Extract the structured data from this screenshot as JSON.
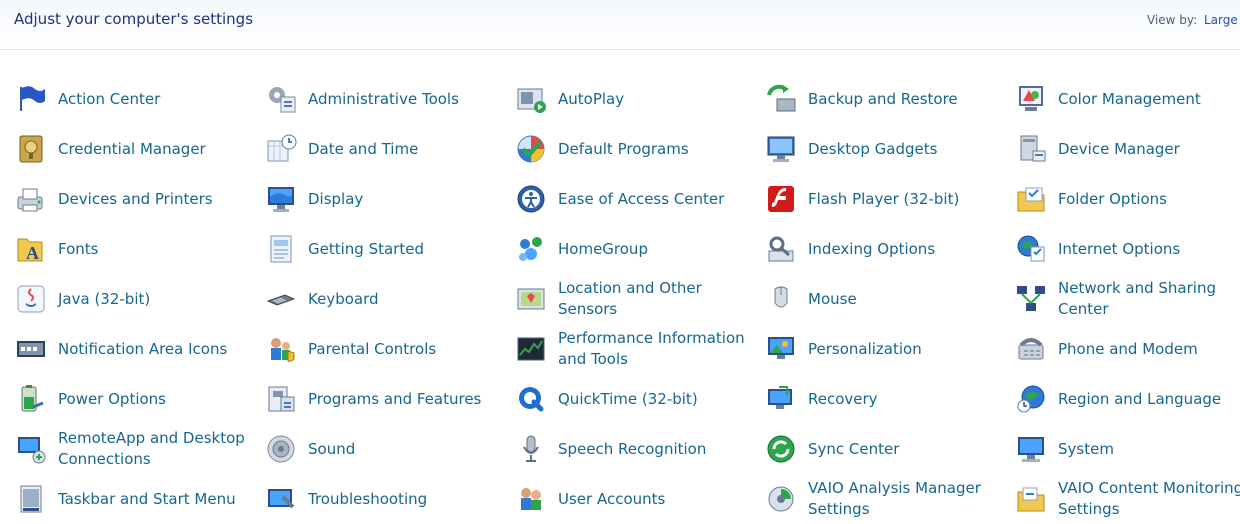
{
  "header": {
    "title": "Adjust your computer's settings",
    "view_by_label": "View by:",
    "view_by_value": "Large i"
  },
  "items": [
    {
      "label": "Action Center",
      "icon": "flag-icon"
    },
    {
      "label": "Administrative Tools",
      "icon": "admin-tools-icon"
    },
    {
      "label": "AutoPlay",
      "icon": "autoplay-icon"
    },
    {
      "label": "Backup and Restore",
      "icon": "backup-icon"
    },
    {
      "label": "Color Management",
      "icon": "color-management-icon"
    },
    {
      "label": "Credential Manager",
      "icon": "credential-vault-icon"
    },
    {
      "label": "Date and Time",
      "icon": "calendar-clock-icon"
    },
    {
      "label": "Default Programs",
      "icon": "default-programs-icon"
    },
    {
      "label": "Desktop Gadgets",
      "icon": "desktop-gadgets-icon"
    },
    {
      "label": "Device Manager",
      "icon": "device-manager-icon"
    },
    {
      "label": "Devices and Printers",
      "icon": "printer-icon"
    },
    {
      "label": "Display",
      "icon": "display-icon"
    },
    {
      "label": "Ease of Access Center",
      "icon": "accessibility-icon"
    },
    {
      "label": "Flash Player (32-bit)",
      "icon": "flash-icon"
    },
    {
      "label": "Folder Options",
      "icon": "folder-icon"
    },
    {
      "label": "Fonts",
      "icon": "fonts-icon"
    },
    {
      "label": "Getting Started",
      "icon": "getting-started-icon"
    },
    {
      "label": "HomeGroup",
      "icon": "homegroup-icon"
    },
    {
      "label": "Indexing Options",
      "icon": "indexing-icon"
    },
    {
      "label": "Internet Options",
      "icon": "globe-icon"
    },
    {
      "label": "Java (32-bit)",
      "icon": "java-icon"
    },
    {
      "label": "Keyboard",
      "icon": "keyboard-icon"
    },
    {
      "label": "Location and Other Sensors",
      "icon": "location-sensor-icon"
    },
    {
      "label": "Mouse",
      "icon": "mouse-icon"
    },
    {
      "label": "Network and Sharing Center",
      "icon": "network-icon"
    },
    {
      "label": "Notification Area Icons",
      "icon": "notification-area-icon"
    },
    {
      "label": "Parental Controls",
      "icon": "parental-controls-icon"
    },
    {
      "label": "Performance Information and Tools",
      "icon": "performance-icon"
    },
    {
      "label": "Personalization",
      "icon": "personalization-icon"
    },
    {
      "label": "Phone and Modem",
      "icon": "phone-icon"
    },
    {
      "label": "Power Options",
      "icon": "battery-icon"
    },
    {
      "label": "Programs and Features",
      "icon": "programs-icon"
    },
    {
      "label": "QuickTime (32-bit)",
      "icon": "quicktime-icon"
    },
    {
      "label": "Recovery",
      "icon": "recovery-icon"
    },
    {
      "label": "Region and Language",
      "icon": "region-globe-icon"
    },
    {
      "label": "RemoteApp and Desktop Connections",
      "icon": "remoteapp-icon"
    },
    {
      "label": "Sound",
      "icon": "speaker-icon"
    },
    {
      "label": "Speech Recognition",
      "icon": "microphone-icon"
    },
    {
      "label": "Sync Center",
      "icon": "sync-icon"
    },
    {
      "label": "System",
      "icon": "system-icon"
    },
    {
      "label": "Taskbar and Start Menu",
      "icon": "taskbar-icon"
    },
    {
      "label": "Troubleshooting",
      "icon": "troubleshooting-icon"
    },
    {
      "label": "User Accounts",
      "icon": "users-icon"
    },
    {
      "label": "VAIO Analysis Manager Settings",
      "icon": "vaio-analysis-icon"
    },
    {
      "label": "VAIO Content Monitoring Settings",
      "icon": "vaio-content-icon"
    }
  ]
}
